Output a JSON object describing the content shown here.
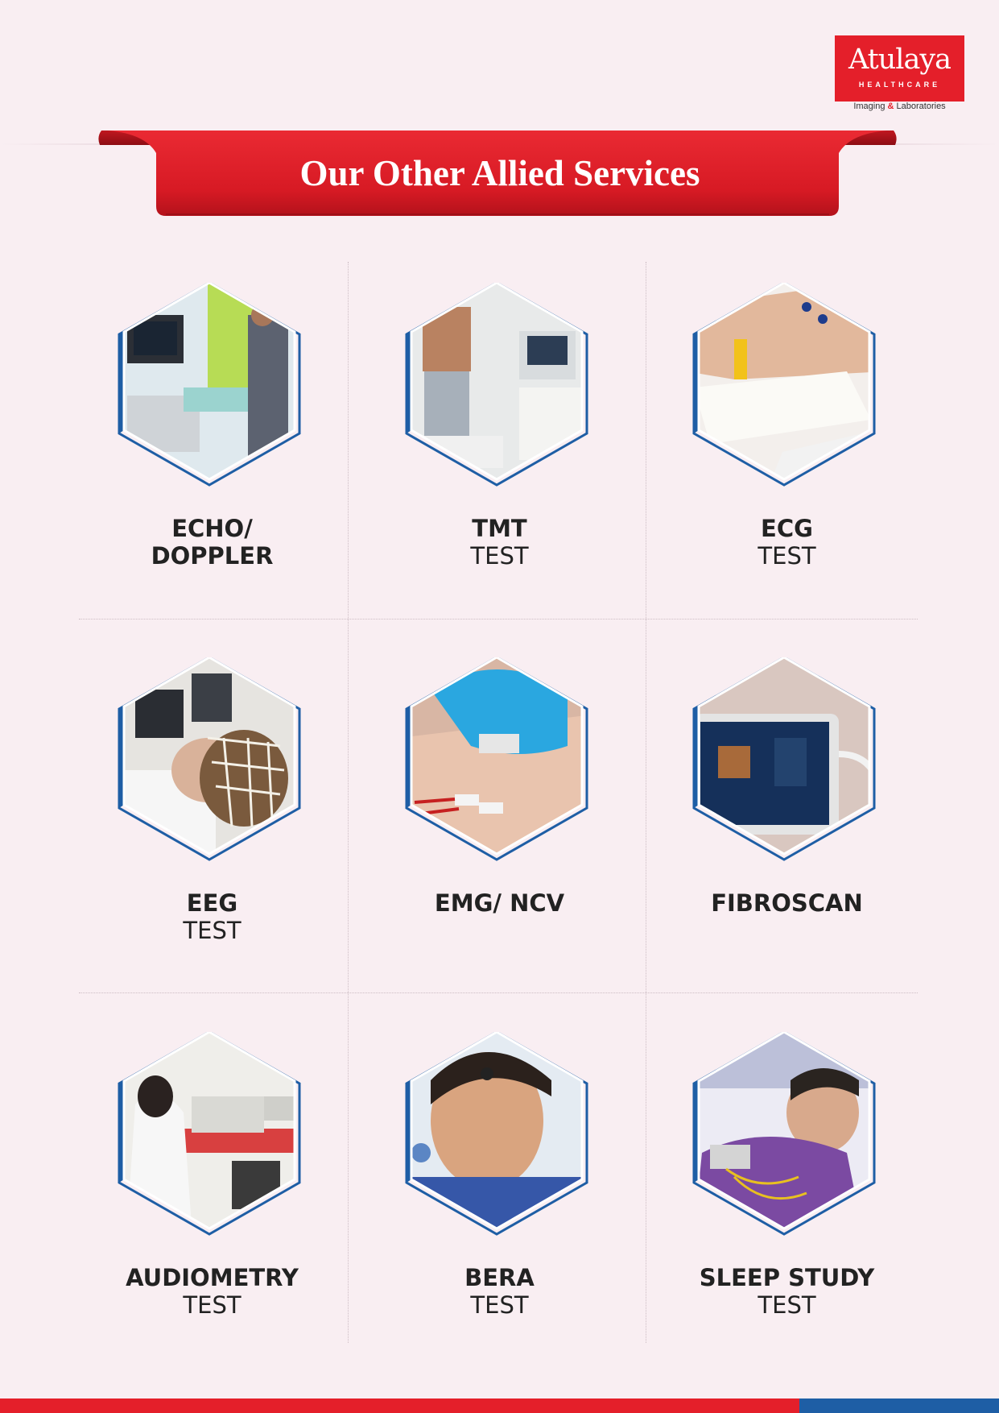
{
  "logo": {
    "brand": "Atulaya",
    "division": "HEALTHCARE",
    "tagline_part1": "Imaging",
    "tagline_amp": "&",
    "tagline_part2": "Laboratories"
  },
  "banner": {
    "title": "Our Other Allied Services"
  },
  "colors": {
    "accent_red": "#e41f2a",
    "accent_blue": "#1e5ea5",
    "background": "#f9eef2"
  },
  "services": [
    {
      "title": "ECHO/",
      "subtitle": "DOPPLER",
      "subtitle_bold": true,
      "photo": "echo-doppler-photo"
    },
    {
      "title": "TMT",
      "subtitle": "TEST",
      "subtitle_bold": false,
      "photo": "treadmill-test-photo"
    },
    {
      "title": "ECG",
      "subtitle": "TEST",
      "subtitle_bold": false,
      "photo": "ecg-photo"
    },
    {
      "title": "EEG",
      "subtitle": "TEST",
      "subtitle_bold": false,
      "photo": "eeg-photo"
    },
    {
      "title": "EMG/ NCV",
      "subtitle": "",
      "subtitle_bold": false,
      "photo": "emg-ncv-photo"
    },
    {
      "title": "FIBROSCAN",
      "subtitle": "",
      "subtitle_bold": false,
      "photo": "fibroscan-photo"
    },
    {
      "title": "AUDIOMETRY",
      "subtitle": "TEST",
      "subtitle_bold": false,
      "photo": "audiometry-photo"
    },
    {
      "title": "BERA",
      "subtitle": "TEST",
      "subtitle_bold": false,
      "photo": "bera-photo"
    },
    {
      "title": "SLEEP STUDY",
      "subtitle": "TEST",
      "subtitle_bold": false,
      "photo": "sleep-study-photo"
    }
  ]
}
